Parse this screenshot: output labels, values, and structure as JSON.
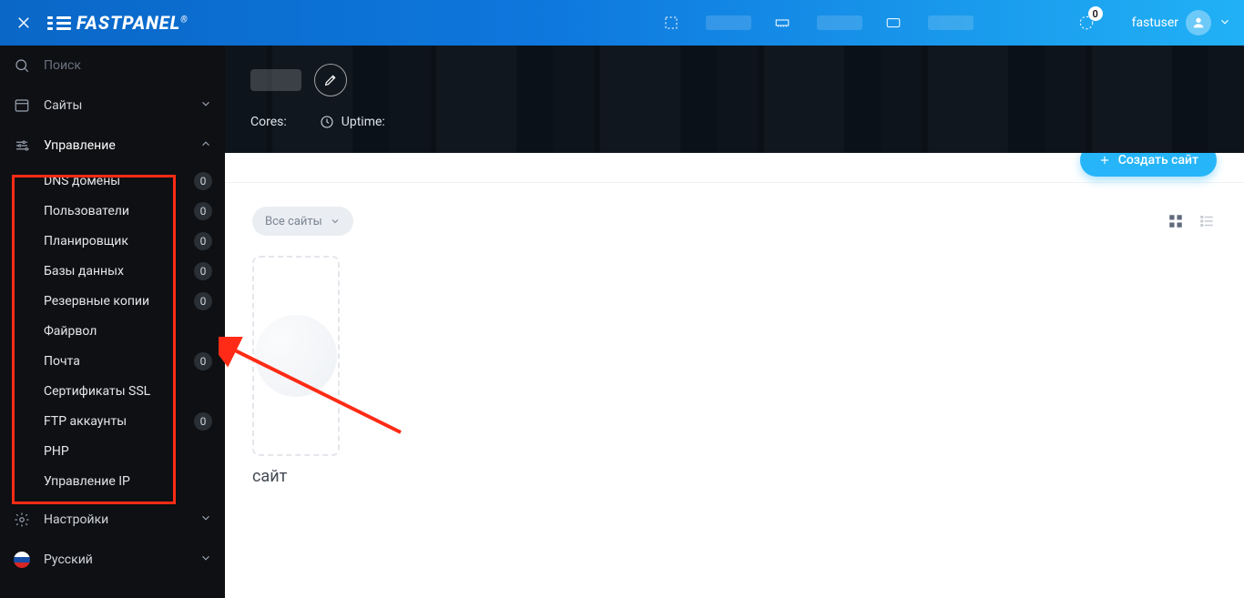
{
  "brand": {
    "name": "FASTPANEL",
    "reg": "®"
  },
  "topbar": {
    "activity_badge": "0",
    "username": "fastuser"
  },
  "sidebar": {
    "search_placeholder": "Поиск",
    "nav": {
      "sites": "Сайты",
      "management": "Управление",
      "settings": "Настройки",
      "language": "Русский"
    },
    "management_items": [
      {
        "label": "DNS домены",
        "badge": "0"
      },
      {
        "label": "Пользователи",
        "badge": "0"
      },
      {
        "label": "Планировщик",
        "badge": "0"
      },
      {
        "label": "Базы данных",
        "badge": "0"
      },
      {
        "label": "Резервные копии",
        "badge": "0"
      },
      {
        "label": "Файрвол",
        "badge": null
      },
      {
        "label": "Почта",
        "badge": "0"
      },
      {
        "label": "Сертификаты SSL",
        "badge": null
      },
      {
        "label": "FTP аккаунты",
        "badge": "0"
      },
      {
        "label": "PHP",
        "badge": null
      },
      {
        "label": "Управление IP",
        "badge": null
      }
    ]
  },
  "hero": {
    "cores_label": "Cores:",
    "uptime_label": "Uptime:"
  },
  "actions": {
    "create_site": "Создать сайт"
  },
  "filter": {
    "all_sites": "Все сайты"
  },
  "card": {
    "text_fragment": "сайт"
  },
  "colors": {
    "accent": "#26b5f8",
    "annotation": "#ff2b16"
  }
}
